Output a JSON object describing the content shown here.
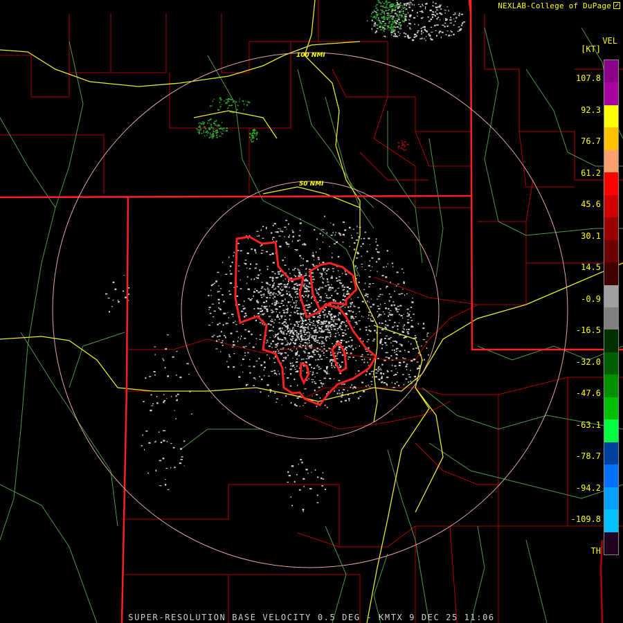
{
  "header": {
    "credit": "NEXLAB-College of DuPage",
    "product_code": "VEL",
    "unit": "[KT]"
  },
  "map": {
    "ring_labels": {
      "inner": "50 NMI",
      "outer": "100 NMI"
    },
    "colors": {
      "state_border": "#ff2020",
      "county_border": "#b00000",
      "highway": "#e8e830",
      "secondary_road": "#4a9a4a",
      "range_ring": "#e0a8a0",
      "warning_polygon": "#ff2020",
      "outbound_echo": "#cfcfcf",
      "inbound_echo": "#2ea02e"
    }
  },
  "color_scale": {
    "labels": [
      "107.8",
      "92.3",
      "76.7",
      "61.2",
      "45.6",
      "30.1",
      "14.5",
      "-0.9",
      "-16.5",
      "-32.0",
      "-47.6",
      "-63.1",
      "-78.7",
      "-94.2",
      "-109.8",
      "TH"
    ],
    "stops": [
      {
        "color": "#8a0088"
      },
      {
        "color": "#a800a0"
      },
      {
        "color": "#ffff00"
      },
      {
        "color": "#ffc000"
      },
      {
        "color": "#ffa070"
      },
      {
        "color": "#ff0000"
      },
      {
        "color": "#d00000"
      },
      {
        "color": "#9a0000"
      },
      {
        "color": "#6a0000"
      },
      {
        "color": "#400000"
      },
      {
        "color": "#a0a0a0"
      },
      {
        "color": "#808080"
      },
      {
        "color": "#003000"
      },
      {
        "color": "#006000"
      },
      {
        "color": "#009000"
      },
      {
        "color": "#00c000"
      },
      {
        "color": "#00ff40"
      },
      {
        "color": "#0040a0"
      },
      {
        "color": "#0070ff"
      },
      {
        "color": "#00a0ff"
      },
      {
        "color": "#00c0ff"
      },
      {
        "color": "#200020"
      }
    ]
  },
  "footer": {
    "caption": "SUPER-RESOLUTION BASE VELOCITY 0.5 DEG - KMTX 9 DEC 25 11:06"
  }
}
